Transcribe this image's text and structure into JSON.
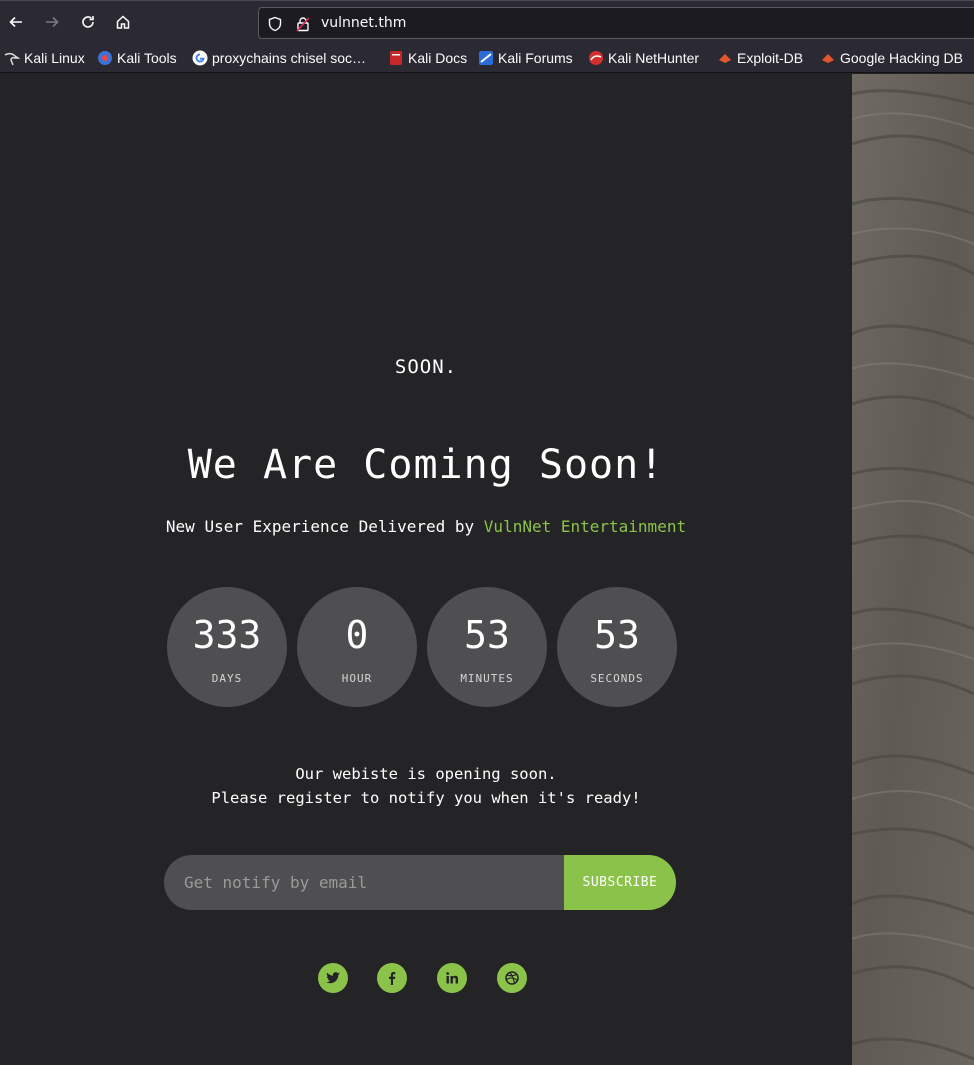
{
  "browser": {
    "url": "vulnnet.thm",
    "bookmarks": [
      {
        "label": "Kali Linux",
        "icon": "kali-dragon-icon"
      },
      {
        "label": "Kali Tools",
        "icon": "kali-tools-icon"
      },
      {
        "label": "proxychains chisel soc…",
        "icon": "google-icon"
      },
      {
        "label": "Kali Docs",
        "icon": "kali-docs-icon"
      },
      {
        "label": "Kali Forums",
        "icon": "kali-forums-icon"
      },
      {
        "label": "Kali NetHunter",
        "icon": "nethunter-icon"
      },
      {
        "label": "Exploit-DB",
        "icon": "exploit-db-icon"
      },
      {
        "label": "Google Hacking DB",
        "icon": "exploit-db-icon"
      }
    ]
  },
  "page": {
    "logo": "SOON.",
    "headline": "We Are Coming Soon!",
    "tagline_prefix": "New User Experience Delivered by ",
    "tagline_brand": "VulnNet Entertainment",
    "countdown": [
      {
        "value": "333",
        "label": "DAYS"
      },
      {
        "value": "0",
        "label": "HOUR"
      },
      {
        "value": "53",
        "label": "MINUTES"
      },
      {
        "value": "53",
        "label": "SECONDS"
      }
    ],
    "message_line1": "Our webiste is opening soon.",
    "message_line2": "Please register to notify you when it's ready!",
    "email_placeholder": "Get notify by email",
    "subscribe_label": "SUBSCRIBE",
    "social": [
      "twitter-icon",
      "facebook-icon",
      "linkedin-icon",
      "dribbble-icon"
    ]
  },
  "colors": {
    "accent": "#8bc34a",
    "background": "#242426",
    "counter_bg": "#4f4f51"
  }
}
